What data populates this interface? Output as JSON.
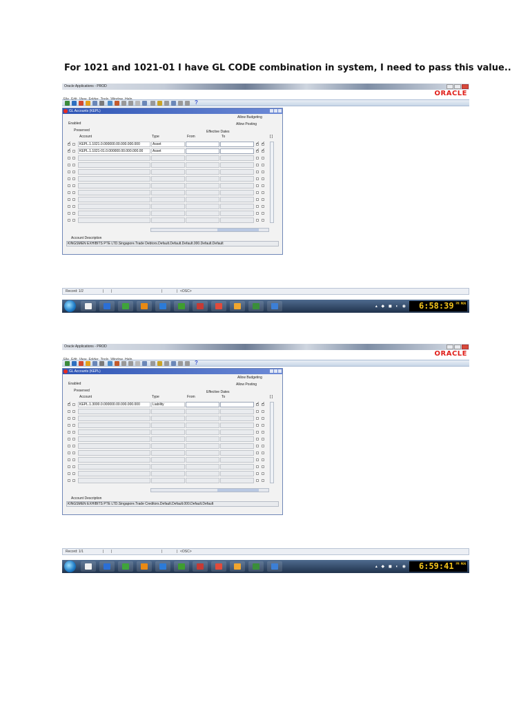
{
  "heading": "For 1021 and 1021-01 I have GL CODE combination in system, I need to pass this value..",
  "menu": [
    "File",
    "Edit",
    "View",
    "Folder",
    "Tools",
    "Window",
    "Help"
  ],
  "brand": "ORACLE",
  "screenshots": [
    {
      "window_title": "Oracle Applications - PROD",
      "form_title": "GL Accounts (KEPL)",
      "labels": {
        "allow_budgeting": "Allow Budgeting",
        "enabled": "Enabled",
        "allow_posting": "Allow Posting",
        "preserved": "Preserved",
        "effective_dates": "Effective Dates",
        "account": "Account",
        "type": "Type",
        "from": "From",
        "to": "To",
        "account_description": "Account Description"
      },
      "rows": [
        {
          "account": "KEPL.1.1021.0.000000.00.000.000.000",
          "type": "Asset"
        },
        {
          "account": "KEPL.1.1021-01.0.000000.00.000.000.00",
          "type": "Asset"
        }
      ],
      "description": "KINGSMEN EXHIBITS PTE LTD.Singapore.Trade Debtors.Default.Default.Default.000.Default.Default",
      "status_record": "Record: 1/2",
      "status_osc": "<OSC>",
      "clock": "6:58:39",
      "clock_ampm": "PM MON"
    },
    {
      "window_title": "Oracle Applications - PROD",
      "form_title": "GL Accounts (KEPL)",
      "labels": {
        "allow_budgeting": "Allow Budgeting",
        "enabled": "Enabled",
        "allow_posting": "Allow Posting",
        "preserved": "Preserved",
        "effective_dates": "Effective Dates",
        "account": "Account",
        "type": "Type",
        "from": "From",
        "to": "To",
        "account_description": "Account Description"
      },
      "rows": [
        {
          "account": "KEPL.1.3000.0.000000.00.000.000.000",
          "type": "Liability"
        }
      ],
      "description": "KINGSMEN EXHIBITS PTE LTD.Singapore.Trade Creditors.Default.Default.000.Default.Default",
      "status_record": "Record: 1/1",
      "status_osc": "<OSC>",
      "clock": "6:59:41",
      "clock_ampm": "PM MON"
    }
  ]
}
